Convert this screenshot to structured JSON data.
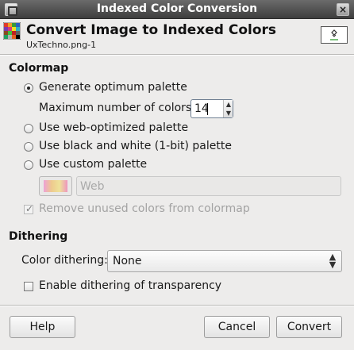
{
  "window": {
    "title": "Indexed Color Conversion",
    "close_glyph": "×"
  },
  "header": {
    "title": "Convert Image to Indexed Colors",
    "subtitle": "UxTechno.png-1",
    "icon": "indexed-palette-icon"
  },
  "colormap": {
    "heading": "Colormap",
    "options": [
      {
        "label": "Generate optimum palette",
        "selected": true
      },
      {
        "label": "Use web-optimized palette",
        "selected": false
      },
      {
        "label": "Use black and white (1-bit) palette",
        "selected": false
      },
      {
        "label": "Use custom palette",
        "selected": false
      }
    ],
    "max_colors_label": "Maximum number of colors:",
    "max_colors_value": "14",
    "custom_palette_name": "Web",
    "remove_unused_label": "Remove unused colors from colormap",
    "remove_unused_checked": true
  },
  "dithering": {
    "heading": "Dithering",
    "color_dithering_label": "Color dithering:",
    "color_dithering_value": "None",
    "transparency_label": "Enable dithering of transparency",
    "transparency_checked": false
  },
  "buttons": {
    "help": "Help",
    "cancel": "Cancel",
    "convert": "Convert"
  },
  "colors": {
    "titlebar": "#4a4a4a",
    "background": "#edeceb",
    "disabled_text": "#a3a3a3"
  }
}
